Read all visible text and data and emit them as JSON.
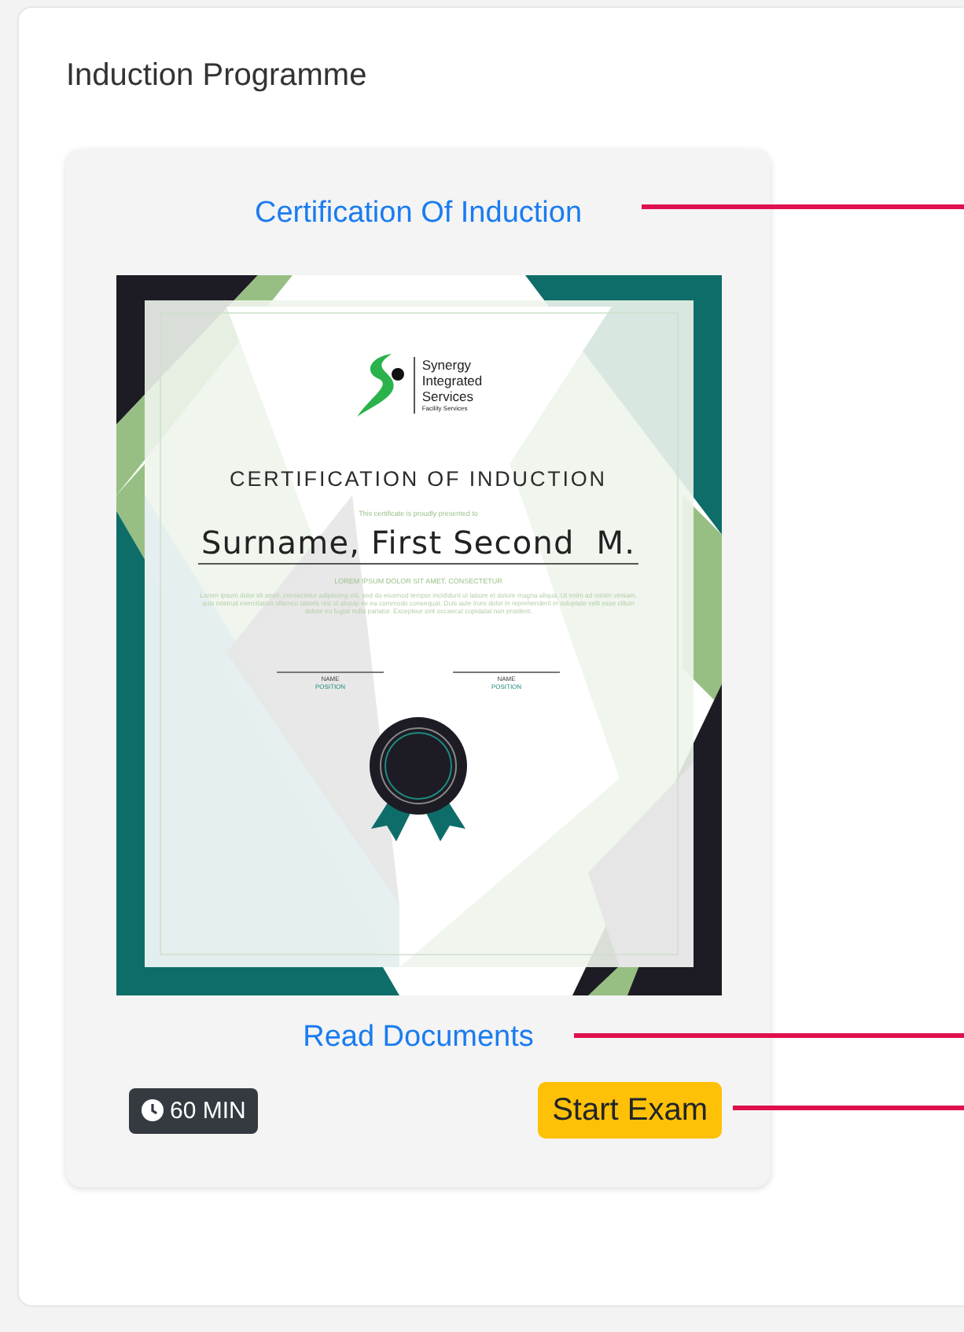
{
  "page": {
    "title": "Induction Programme"
  },
  "card": {
    "title_link": "Certification Of Induction",
    "certificate": {
      "logo_lines": [
        "Synergy",
        "Integrated",
        "Services"
      ],
      "logo_tagline": "Facility Services",
      "heading": "CERTIFICATION OF INDUCTION",
      "presented_to": "This certificate is proudly presented to",
      "recipient": "Surname, First Second  M.",
      "subheading": "LOREM IPSUM DOLOR SIT AMET, CONSECTETUR",
      "body": "Lorem ipsum dolor sit amet, consectetur adipiscing elit, sed do eiusmod tempor incididunt ut labore et dolore magna aliqua. Ut enim ad minim veniam, quis nostrud exercitation ullamco laboris nisi ut aliquip ex ea commodo consequat. Duis aute irure dolor in reprehenderit in voluptate velit esse cillum dolore eu fugiat nulla pariatur. Excepteur sint occaecat cupidatat non proident.",
      "signatures": [
        {
          "name": "NAME",
          "position": "POSITION"
        },
        {
          "name": "NAME",
          "position": "POSITION"
        }
      ]
    },
    "read_link": "Read Documents",
    "duration": "60 MIN",
    "start_button": "Start Exam"
  }
}
